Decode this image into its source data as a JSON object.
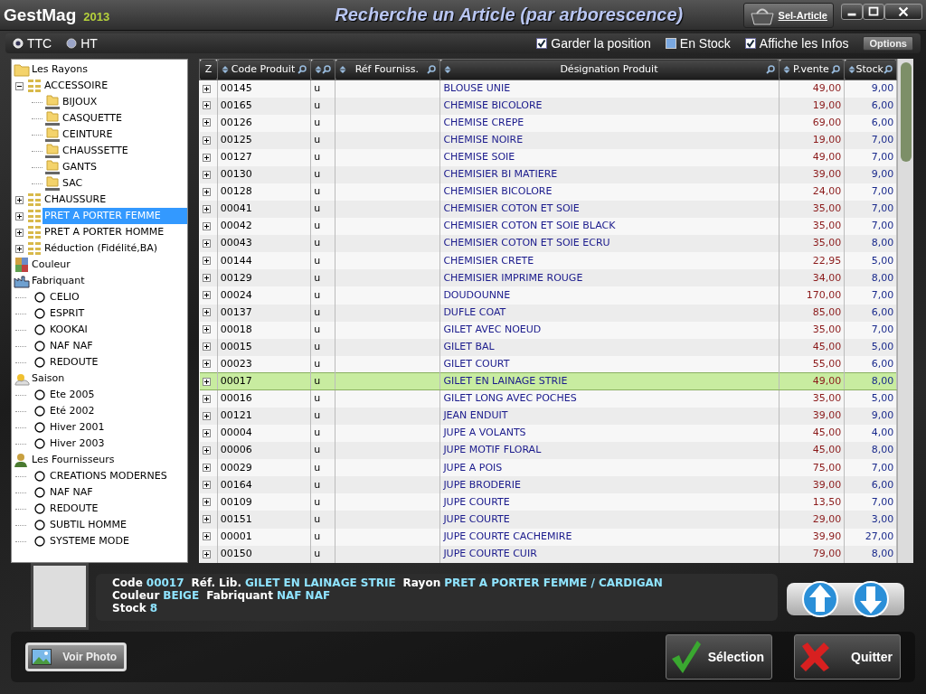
{
  "title_bar": {
    "app_name": "GestMag",
    "app_year": "2013",
    "window_title": "Recherche un Article (par arborescence)",
    "sel_article_button": "Sel-Article"
  },
  "price_mode": [
    {
      "label": "TTC",
      "selected": true
    },
    {
      "label": "HT",
      "selected": false
    }
  ],
  "options": [
    {
      "label": "Garder la position",
      "checked": true
    },
    {
      "label": "En Stock",
      "checked": false
    },
    {
      "label": "Affiche les Infos",
      "checked": true
    }
  ],
  "options_button": "Options",
  "tree": [
    {
      "label": "Les Rayons",
      "kind": "folder",
      "selected": false,
      "children": [
        {
          "label": "ACCESSOIRE",
          "kind": "grid",
          "expanded": true,
          "selected": false,
          "children": [
            {
              "label": "BIJOUX",
              "kind": "subfolder",
              "selected": false
            },
            {
              "label": "CASQUETTE",
              "kind": "subfolder",
              "selected": false
            },
            {
              "label": "CEINTURE",
              "kind": "subfolder",
              "selected": false
            },
            {
              "label": "CHAUSSETTE",
              "kind": "subfolder",
              "selected": false
            },
            {
              "label": "GANTS",
              "kind": "subfolder",
              "selected": false
            },
            {
              "label": "SAC",
              "kind": "subfolder",
              "selected": false
            }
          ]
        },
        {
          "label": "CHAUSSURE",
          "kind": "grid",
          "expanded": false,
          "selected": false
        },
        {
          "label": "PRET A PORTER FEMME",
          "kind": "grid",
          "expanded": false,
          "selected": true
        },
        {
          "label": "PRET A PORTER HOMME",
          "kind": "grid",
          "expanded": false,
          "selected": false
        },
        {
          "label": "Réduction (Fidélité,BA)",
          "kind": "grid",
          "expanded": false,
          "selected": false
        }
      ]
    },
    {
      "label": "Couleur",
      "kind": "palette",
      "selected": false
    },
    {
      "label": "Fabriquant",
      "kind": "factory",
      "selected": false,
      "children": [
        {
          "label": "CELIO",
          "kind": "circle",
          "selected": false
        },
        {
          "label": "ESPRIT",
          "kind": "circle",
          "selected": false
        },
        {
          "label": "KOOKAI",
          "kind": "circle",
          "selected": false
        },
        {
          "label": "NAF NAF",
          "kind": "circle",
          "selected": false
        },
        {
          "label": "REDOUTE",
          "kind": "circle",
          "selected": false
        }
      ]
    },
    {
      "label": "Saison",
      "kind": "sun",
      "selected": false,
      "children": [
        {
          "label": "Ete 2005",
          "kind": "circle",
          "selected": false
        },
        {
          "label": "Eté 2002",
          "kind": "circle",
          "selected": false
        },
        {
          "label": "Hiver 2001",
          "kind": "circle",
          "selected": false
        },
        {
          "label": "Hiver 2003",
          "kind": "circle",
          "selected": false
        }
      ]
    },
    {
      "label": "Les Fournisseurs",
      "kind": "person",
      "selected": false,
      "children": [
        {
          "label": "CREATIONS MODERNES",
          "kind": "circle",
          "selected": false
        },
        {
          "label": "NAF NAF",
          "kind": "circle",
          "selected": false
        },
        {
          "label": "REDOUTE",
          "kind": "circle",
          "selected": false
        },
        {
          "label": "SUBTIL HOMME",
          "kind": "circle",
          "selected": false
        },
        {
          "label": "SYSTEME MODE",
          "kind": "circle",
          "selected": false
        }
      ]
    }
  ],
  "table": {
    "columns": [
      "Z",
      "Code Produit",
      "",
      "Réf Fourniss.",
      "Désignation Produit",
      "P.vente",
      "Stock"
    ],
    "rows": [
      {
        "code": "00145",
        "unit": "u",
        "designation": "BLOUSE UNIE",
        "price": "49,00",
        "stock": "9,00",
        "selected": false
      },
      {
        "code": "00165",
        "unit": "u",
        "designation": "CHEMISE BICOLORE",
        "price": "19,00",
        "stock": "6,00",
        "selected": false
      },
      {
        "code": "00126",
        "unit": "u",
        "designation": "CHEMISE CREPE",
        "price": "69,00",
        "stock": "6,00",
        "selected": false
      },
      {
        "code": "00125",
        "unit": "u",
        "designation": "CHEMISE NOIRE",
        "price": "19,00",
        "stock": "7,00",
        "selected": false
      },
      {
        "code": "00127",
        "unit": "u",
        "designation": "CHEMISE SOIE",
        "price": "49,00",
        "stock": "7,00",
        "selected": false
      },
      {
        "code": "00130",
        "unit": "u",
        "designation": "CHEMISIER BI MATIERE",
        "price": "39,00",
        "stock": "9,00",
        "selected": false
      },
      {
        "code": "00128",
        "unit": "u",
        "designation": "CHEMISIER BICOLORE",
        "price": "24,00",
        "stock": "7,00",
        "selected": false
      },
      {
        "code": "00041",
        "unit": "u",
        "designation": "CHEMISIER COTON ET SOIE",
        "price": "35,00",
        "stock": "7,00",
        "selected": false
      },
      {
        "code": "00042",
        "unit": "u",
        "designation": "CHEMISIER COTON ET SOIE BLACK",
        "price": "35,00",
        "stock": "7,00",
        "selected": false
      },
      {
        "code": "00043",
        "unit": "u",
        "designation": "CHEMISIER COTON ET SOIE ECRU",
        "price": "35,00",
        "stock": "8,00",
        "selected": false
      },
      {
        "code": "00144",
        "unit": "u",
        "designation": "CHEMISIER CRETE",
        "price": "22,95",
        "stock": "5,00",
        "selected": false
      },
      {
        "code": "00129",
        "unit": "u",
        "designation": "CHEMISIER IMPRIME ROUGE",
        "price": "34,00",
        "stock": "8,00",
        "selected": false
      },
      {
        "code": "00024",
        "unit": "u",
        "designation": "DOUDOUNNE",
        "price": "170,00",
        "stock": "7,00",
        "selected": false
      },
      {
        "code": "00137",
        "unit": "u",
        "designation": "DUFLE COAT",
        "price": "85,00",
        "stock": "6,00",
        "selected": false
      },
      {
        "code": "00018",
        "unit": "u",
        "designation": "GILET AVEC NOEUD",
        "price": "35,00",
        "stock": "7,00",
        "selected": false
      },
      {
        "code": "00015",
        "unit": "u",
        "designation": "GILET BAL",
        "price": "45,00",
        "stock": "5,00",
        "selected": false
      },
      {
        "code": "00023",
        "unit": "u",
        "designation": "GILET COURT",
        "price": "55,00",
        "stock": "6,00",
        "selected": false
      },
      {
        "code": "00017",
        "unit": "u",
        "designation": "GILET EN LAINAGE STRIE",
        "price": "49,00",
        "stock": "8,00",
        "selected": true
      },
      {
        "code": "00016",
        "unit": "u",
        "designation": "GILET LONG AVEC POCHES",
        "price": "35,00",
        "stock": "5,00",
        "selected": false
      },
      {
        "code": "00121",
        "unit": "u",
        "designation": "JEAN ENDUIT",
        "price": "39,00",
        "stock": "9,00",
        "selected": false
      },
      {
        "code": "00004",
        "unit": "u",
        "designation": "JUPE  A VOLANTS",
        "price": "45,00",
        "stock": "4,00",
        "selected": false
      },
      {
        "code": "00006",
        "unit": "u",
        "designation": "JUPE  MOTIF FLORAL",
        "price": "45,00",
        "stock": "8,00",
        "selected": false
      },
      {
        "code": "00029",
        "unit": "u",
        "designation": "JUPE A POIS",
        "price": "75,00",
        "stock": "7,00",
        "selected": false
      },
      {
        "code": "00164",
        "unit": "u",
        "designation": "JUPE BRODERIE",
        "price": "39,00",
        "stock": "6,00",
        "selected": false
      },
      {
        "code": "00109",
        "unit": "u",
        "designation": "JUPE COURTE",
        "price": "13,50",
        "stock": "7,00",
        "selected": false
      },
      {
        "code": "00151",
        "unit": "u",
        "designation": "JUPE COURTE",
        "price": "29,00",
        "stock": "3,00",
        "selected": false
      },
      {
        "code": "00001",
        "unit": "u",
        "designation": "JUPE COURTE CACHEMIRE",
        "price": "39,90",
        "stock": "27,00",
        "selected": false
      },
      {
        "code": "00150",
        "unit": "u",
        "designation": "JUPE COURTE CUIR",
        "price": "79,00",
        "stock": "8,00",
        "selected": false
      }
    ]
  },
  "detail": {
    "lines": [
      [
        {
          "label": "Code",
          "value": "00017"
        },
        {
          "label": "Réf."
        },
        {
          "label": "Lib.",
          "value": "GILET EN LAINAGE STRIE"
        },
        {
          "label": "Rayon",
          "value": "PRET A PORTER FEMME / CARDIGAN"
        }
      ],
      [
        {
          "label": "Couleur",
          "value": "BEIGE"
        },
        {
          "label": "Fabriquant",
          "value": "NAF NAF"
        }
      ],
      [
        {
          "label": "Stock",
          "value": "8"
        }
      ]
    ]
  },
  "buttons": {
    "photo": "Voir Photo",
    "select": "Sélection",
    "quit": "Quitter"
  }
}
